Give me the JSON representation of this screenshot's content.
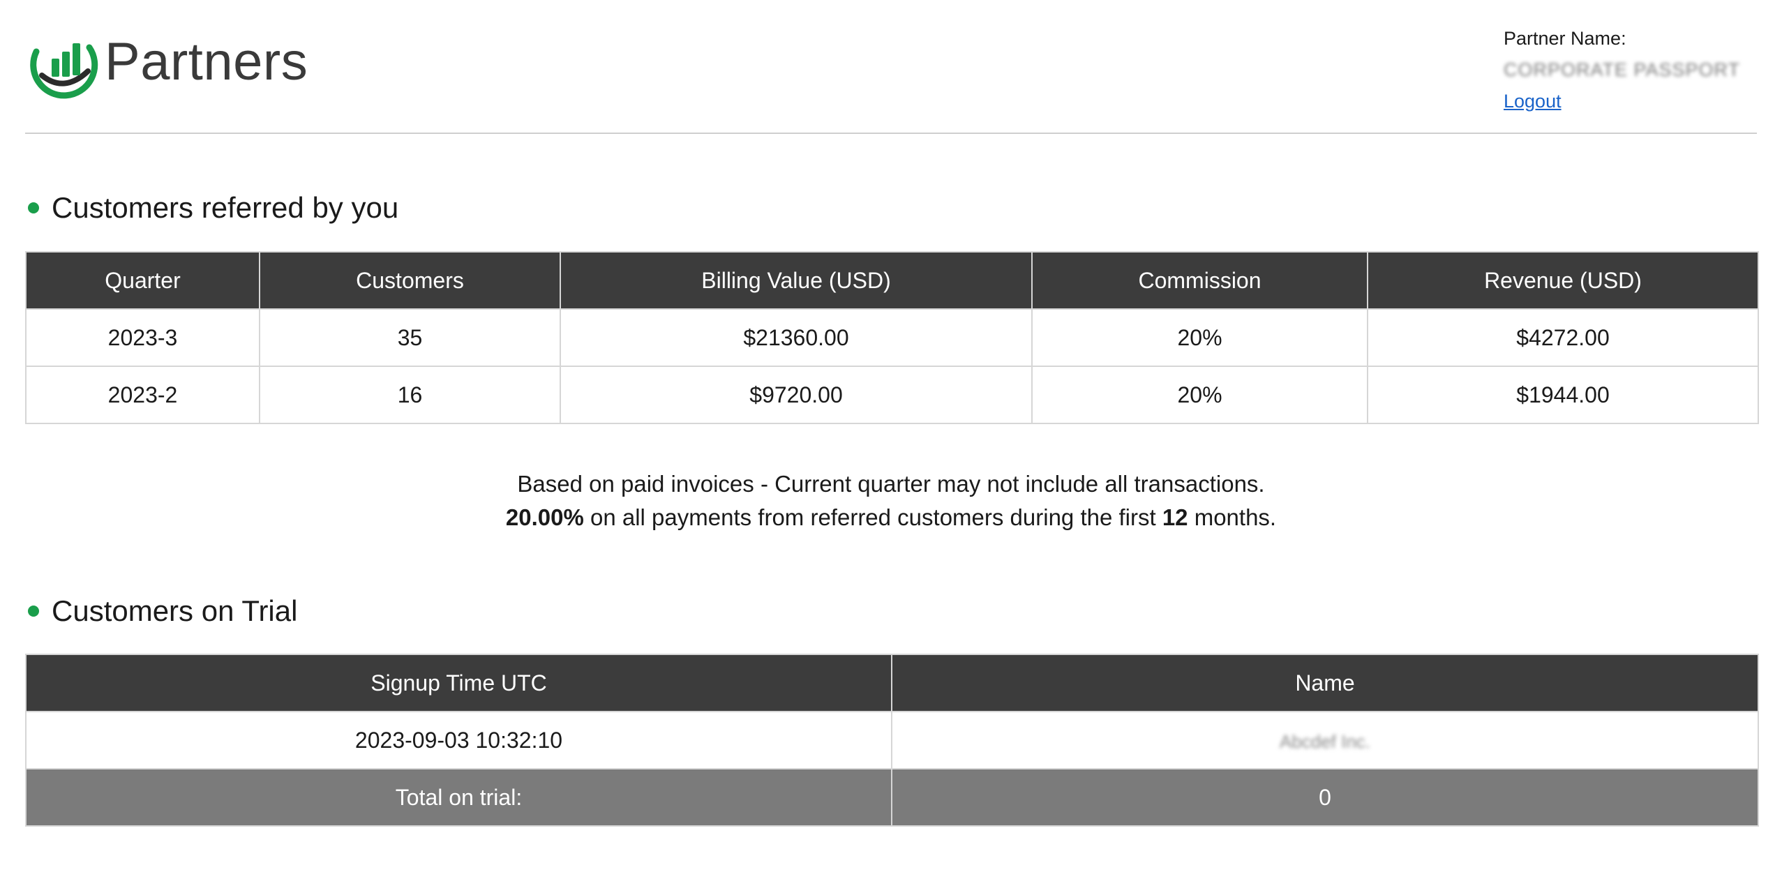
{
  "brand": {
    "name": "Partners",
    "colors": {
      "logo_green": "#1a9e4b",
      "logo_dark": "#2b2b2b"
    }
  },
  "partner": {
    "label": "Partner Name:",
    "value": "CORPORATE PASSPORT",
    "logout_label": "Logout"
  },
  "referred": {
    "title": "Customers referred by you",
    "columns": [
      "Quarter",
      "Customers",
      "Billing Value (USD)",
      "Commission",
      "Revenue (USD)"
    ],
    "rows": [
      [
        "2023-3",
        "35",
        "$21360.00",
        "20%",
        "$4272.00"
      ],
      [
        "2023-2",
        "16",
        "$9720.00",
        "20%",
        "$1944.00"
      ]
    ]
  },
  "notes": {
    "line1": "Based on paid invoices - Current quarter may not include all transactions.",
    "rate": "20.00%",
    "line2_mid": " on all payments from referred customers during the first ",
    "months": "12",
    "line2_end": " months."
  },
  "trial": {
    "title": "Customers on Trial",
    "columns": [
      "Signup Time UTC",
      "Name"
    ],
    "rows": [
      [
        "2023-09-03 10:32:10",
        "Abcdef Inc."
      ]
    ],
    "total_label": "Total on trial:",
    "total_value": "0"
  },
  "icons": {
    "logo": "growth-chart-logo-icon",
    "bullet": "green-dot-icon"
  },
  "colors": {
    "header_bg": "#3c3c3c",
    "total_row_bg": "#7b7b7b",
    "link": "#1a63c9",
    "accent": "#1a9e4b"
  }
}
